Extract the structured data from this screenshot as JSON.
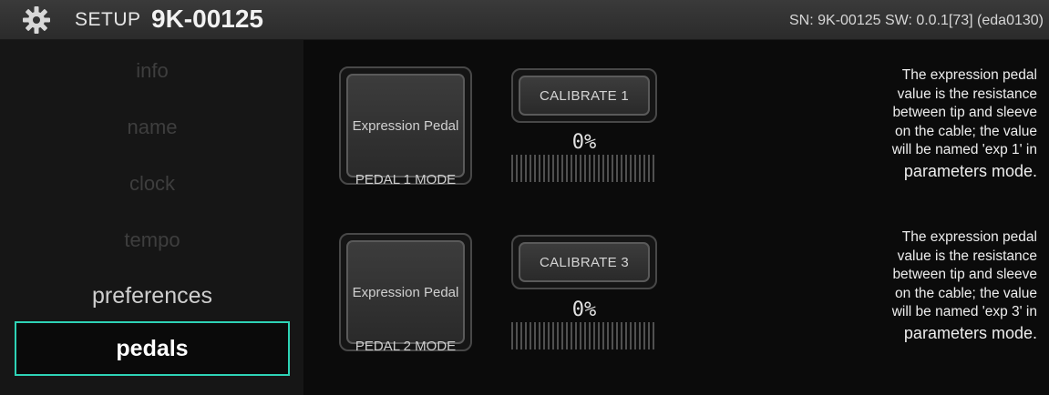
{
  "header": {
    "icon": "gear-icon",
    "setup_label": "SETUP",
    "device_id": "9K-00125",
    "sn_info": "SN: 9K-00125 SW: 0.0.1[73] (eda0130)"
  },
  "sidebar": {
    "items": [
      {
        "label": "info",
        "state": "disabled"
      },
      {
        "label": "name",
        "state": "disabled"
      },
      {
        "label": "clock",
        "state": "disabled"
      },
      {
        "label": "tempo",
        "state": "disabled"
      },
      {
        "label": "preferences",
        "state": "enabled"
      },
      {
        "label": "pedals",
        "state": "active"
      }
    ],
    "active_color": "#2ed3b6"
  },
  "pedals": [
    {
      "mode_button_label": "Expression Pedal",
      "mode_label": "PEDAL 1 MODE",
      "calibrate_label": "CALIBRATE 1",
      "percent": "0%",
      "meter_level": 0,
      "description_lines": [
        "The expression pedal",
        "value is the resistance",
        "between tip and sleeve",
        "on the cable; the value",
        "will be named 'exp 1' in"
      ],
      "description_last": "parameters mode."
    },
    {
      "mode_button_label": "Expression Pedal",
      "mode_label": "PEDAL 2 MODE",
      "calibrate_label": "CALIBRATE 3",
      "percent": "0%",
      "meter_level": 0,
      "description_lines": [
        "The expression pedal",
        "value is the resistance",
        "between tip and sleeve",
        "on the cable; the value",
        "will be named 'exp 3' in"
      ],
      "description_last": "parameters mode."
    }
  ]
}
